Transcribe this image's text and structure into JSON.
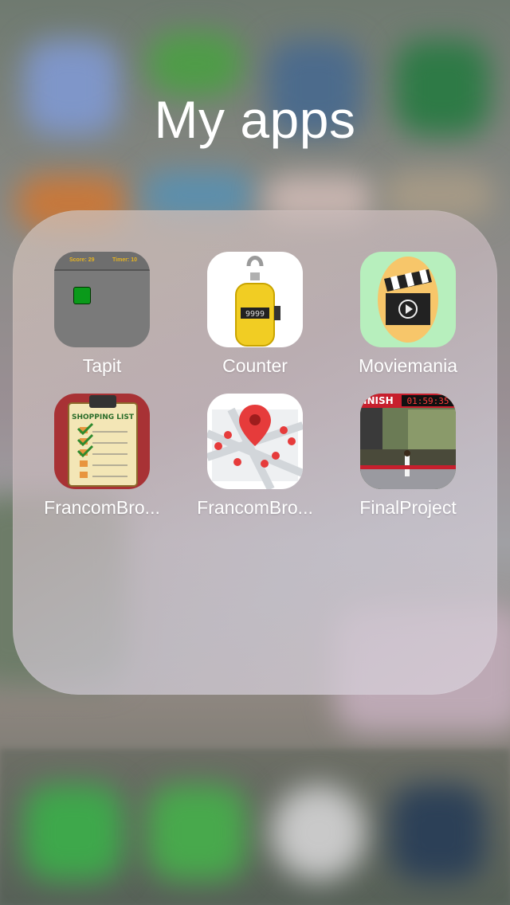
{
  "folder": {
    "title": "My apps"
  },
  "apps": [
    {
      "label": "Tapit",
      "icon": "tapit-game-icon",
      "score_text": "Score: 29",
      "timer_text": "Timer: 10"
    },
    {
      "label": "Counter",
      "icon": "tally-counter-icon",
      "display": "9999"
    },
    {
      "label": "Moviemania",
      "icon": "clapperboard-icon"
    },
    {
      "label": "FrancomBro...",
      "icon": "shopping-list-icon",
      "caption": "SHOPPING LIST"
    },
    {
      "label": "FrancomBro...",
      "icon": "map-pins-icon"
    },
    {
      "label": "FinalProject",
      "icon": "marathon-finish-photo-icon",
      "banner_text": "INISH",
      "clock_text": "01:59:35"
    }
  ],
  "dock": {
    "items": [
      "phone-icon",
      "messages-icon",
      "safari-icon",
      "custom-app-icon"
    ]
  },
  "colors": {
    "folder_bg": "#c9bcbc",
    "label": "#ffffff",
    "tapit_square": "#0a9a1a",
    "shopping_bg": "#a83235",
    "movie_bg": "#b7efbd",
    "map_pin": "#e63b3b"
  }
}
